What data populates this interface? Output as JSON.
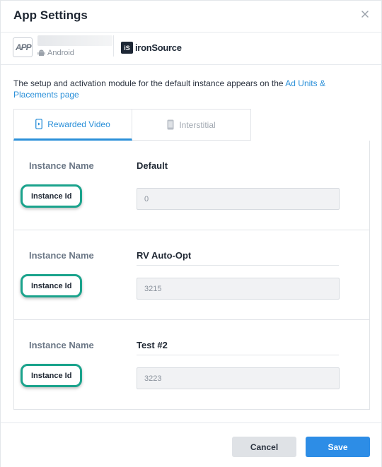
{
  "modal": {
    "title": "App Settings"
  },
  "app": {
    "platform": "Android",
    "network_name": "ironSource",
    "app_logo_text": "APP",
    "network_logo_text": "iS"
  },
  "description": {
    "text": "The setup and activation module for the default instance appears on the ",
    "link": "Ad Units & Placements page"
  },
  "tabs": [
    {
      "label": "Rewarded Video",
      "active": true,
      "icon": "phone-video-icon"
    },
    {
      "label": "Interstitial",
      "active": false,
      "icon": "phone-icon"
    }
  ],
  "instances": [
    {
      "name_label": "Instance Name",
      "name": "Default",
      "id_label": "Instance Id",
      "id_value": "0"
    },
    {
      "name_label": "Instance Name",
      "name": "RV Auto-Opt",
      "id_label": "Instance Id",
      "id_value": "3215"
    },
    {
      "name_label": "Instance Name",
      "name": "Test #2",
      "id_label": "Instance Id",
      "id_value": "3223"
    }
  ],
  "footer": {
    "cancel_label": "Cancel",
    "save_label": "Save"
  },
  "colors": {
    "accent": "#2b90d9",
    "highlight": "#1aa38c",
    "save_button": "#2d8de6"
  }
}
